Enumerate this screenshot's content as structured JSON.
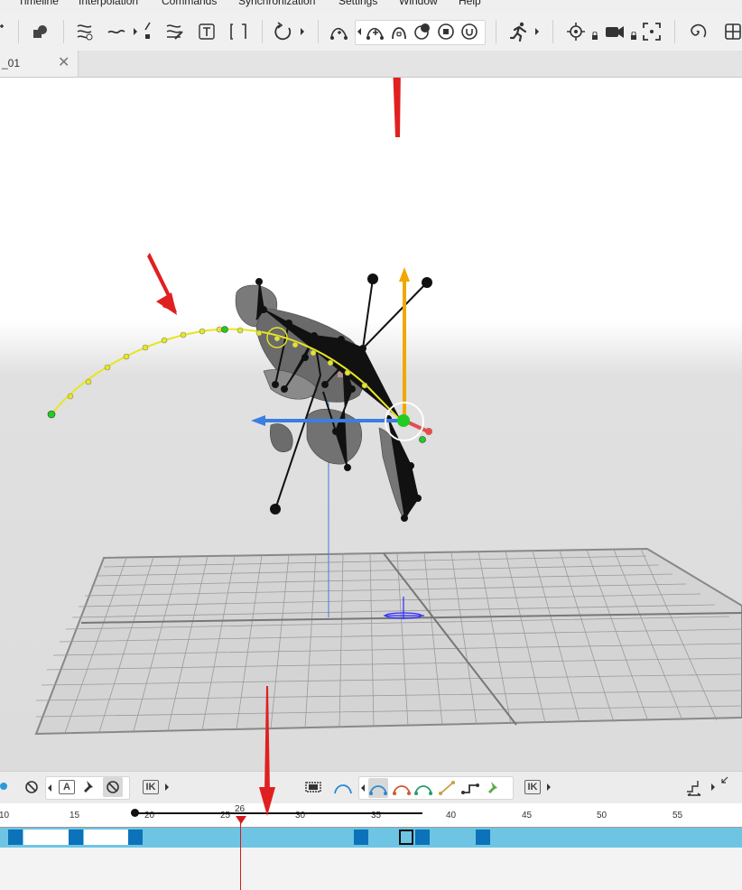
{
  "menu": [
    "Timeline",
    "Interpolation",
    "Commands",
    "Synchronization",
    "Settings",
    "Window",
    "Help"
  ],
  "tab": {
    "label": "_01",
    "close": "✕"
  },
  "timeline": {
    "ticks": [
      "10",
      "15",
      "20",
      "25",
      "30",
      "35",
      "40",
      "45",
      "50",
      "55"
    ],
    "current_frame": "26",
    "ik_label": "IK",
    "auto_key_label": "A"
  },
  "colors": {
    "accent": "#0c72b9",
    "track": "#6ec5e3",
    "playhead": "#d61a1a",
    "motion_path": "#e6e620",
    "annotation_arrow": "#e02020"
  }
}
